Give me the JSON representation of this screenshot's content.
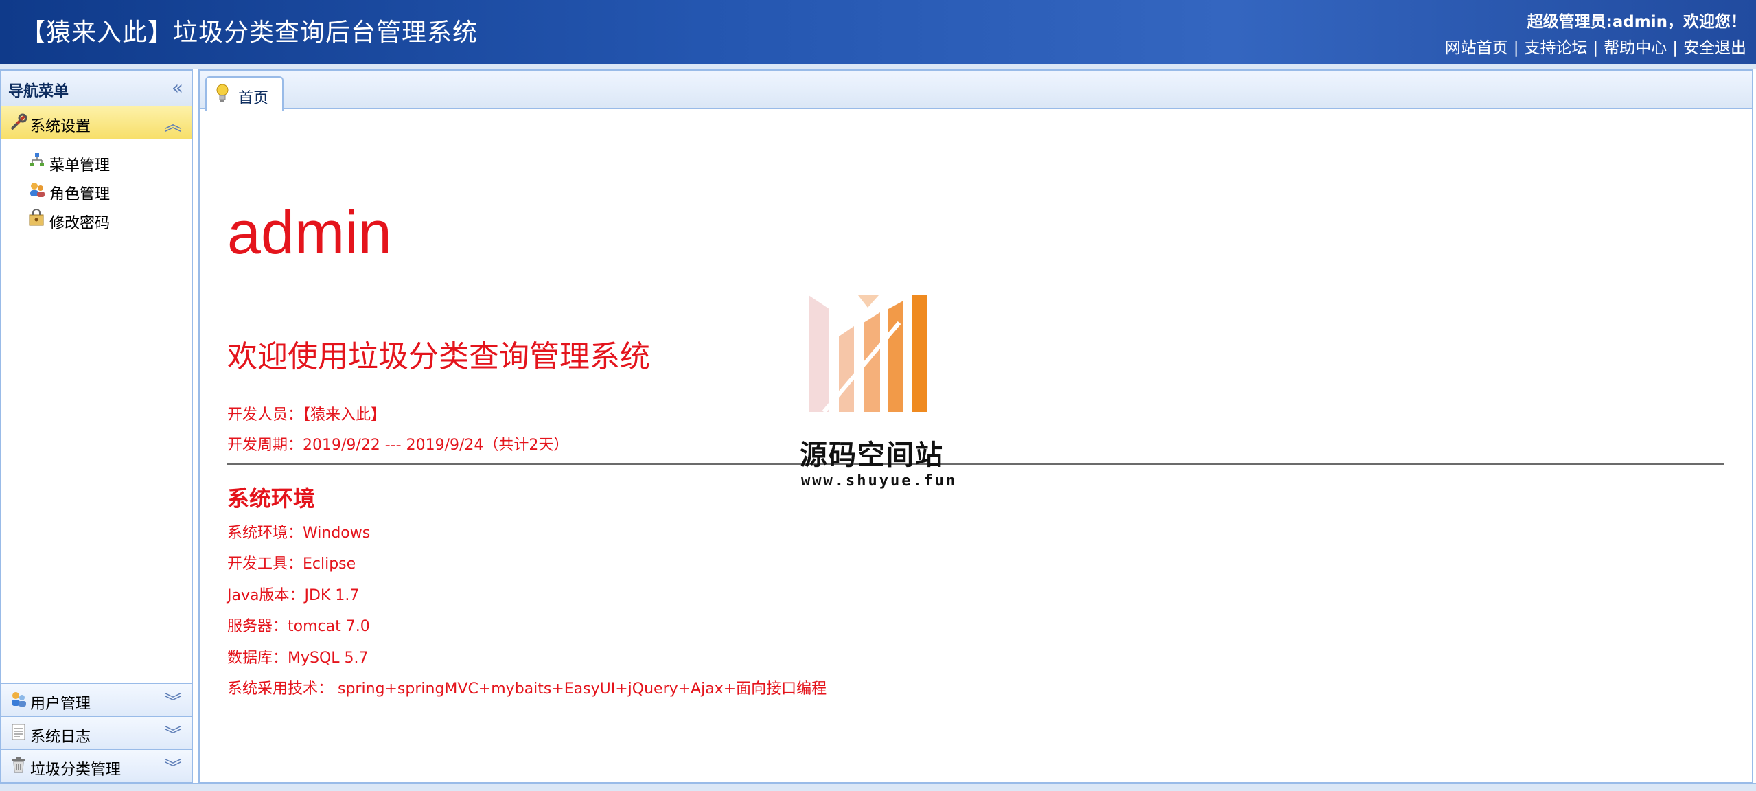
{
  "header": {
    "title": "【猿来入此】垃圾分类查询后台管理系统",
    "welcome": "超级管理员:admin，欢迎您！",
    "links": [
      "网站首页",
      "支持论坛",
      "帮助中心",
      "安全退出"
    ]
  },
  "nav": {
    "title": "导航菜单",
    "sections": [
      {
        "label": "系统设置",
        "icon": "tools-icon",
        "expanded": true,
        "items": [
          {
            "label": "菜单管理",
            "icon": "sitemap-icon"
          },
          {
            "label": "角色管理",
            "icon": "users-role-icon"
          },
          {
            "label": "修改密码",
            "icon": "password-lock-icon"
          }
        ]
      },
      {
        "label": "用户管理",
        "icon": "user-group-icon",
        "expanded": false
      },
      {
        "label": "系统日志",
        "icon": "log-icon",
        "expanded": false
      },
      {
        "label": "垃圾分类管理",
        "icon": "trash-icon",
        "expanded": false
      }
    ]
  },
  "tabs": [
    {
      "label": "首页",
      "icon": "lightbulb-icon"
    }
  ],
  "main": {
    "username": "admin",
    "welcome": "欢迎使用垃圾分类查询管理系统",
    "developer": "开发人员：【猿来入此】",
    "period": "开发周期：2019/9/22 --- 2019/9/24（共计2天）",
    "env_title": "系统环境",
    "env_lines": [
      "系统环境：Windows",
      "开发工具：Eclipse",
      "Java版本：JDK 1.7",
      "服务器：tomcat 7.0",
      "数据库：MySQL 5.7",
      "系统采用技术： spring+springMVC+mybaits+EasyUI+jQuery+Ajax+面向接口编程"
    ]
  },
  "watermark": {
    "name": "源码空间站",
    "url": "www.shuyue.fun"
  },
  "colors": {
    "accent": "#e4141c",
    "header": "#2456b0",
    "border": "#99bbe8",
    "active_section": "#f7df6a"
  }
}
